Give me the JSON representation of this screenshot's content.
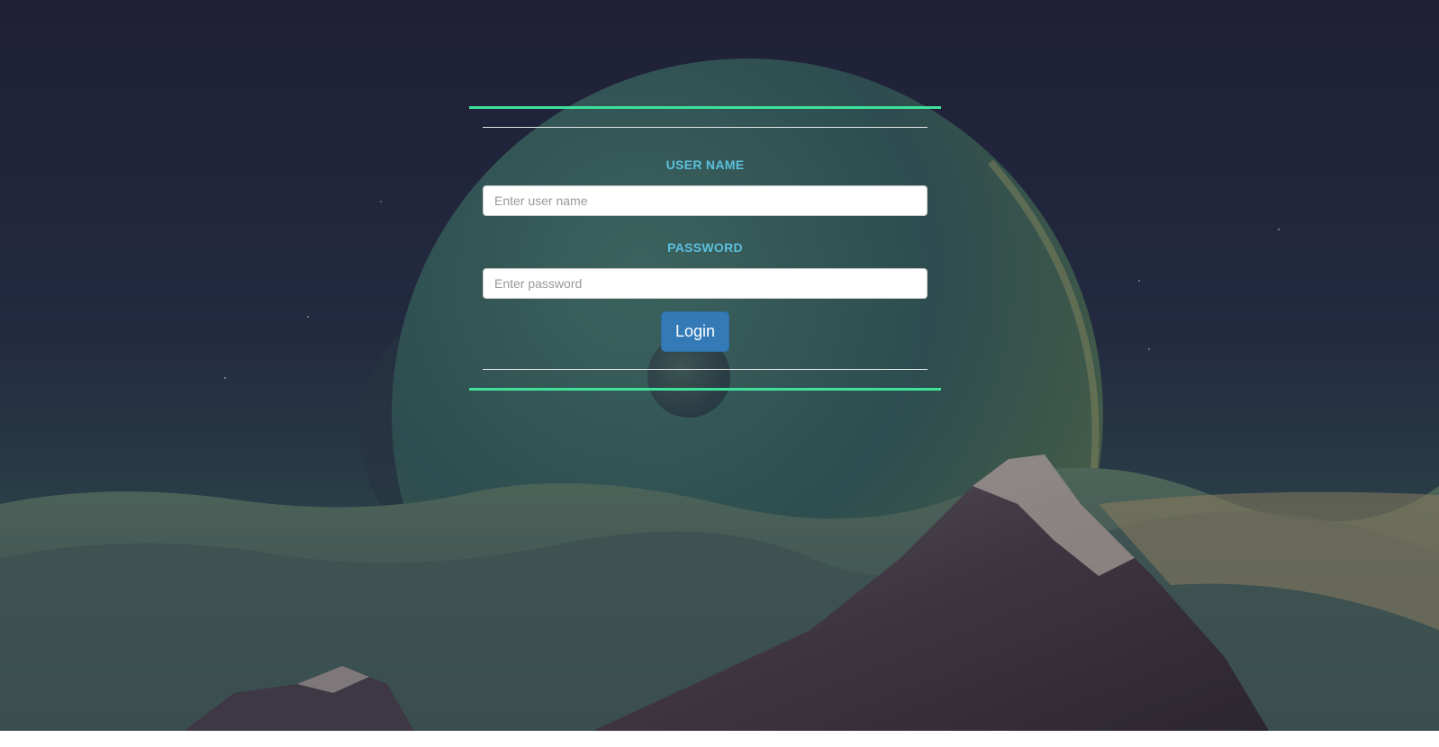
{
  "login": {
    "username_label": "USER NAME",
    "username_placeholder": "Enter user name",
    "username_value": "",
    "password_label": "PASSWORD",
    "password_placeholder": "Enter password",
    "password_value": "",
    "submit_label": "Login"
  },
  "colors": {
    "accent_line": "#3ee09a",
    "label_text": "#5bc0de",
    "button_bg": "#337ab7",
    "background_sky": "#1f2238"
  }
}
